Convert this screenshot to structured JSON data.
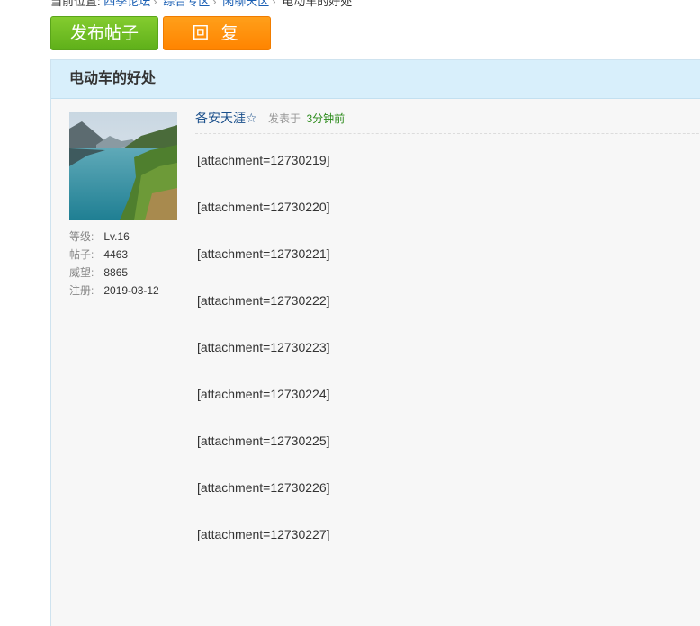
{
  "breadcrumb": {
    "items": [
      "当前位置:",
      "四季论坛",
      "综合专区",
      "闲聊天区",
      "电动车的好处"
    ]
  },
  "actions": {
    "post_label": "发布帖子",
    "reply_label": "回 复"
  },
  "thread": {
    "title": "电动车的好处"
  },
  "author": {
    "name": "各安天涯☆",
    "avatar_alt": "lake and mountain landscape",
    "stats": [
      {
        "label": "等级:",
        "value": "Lv.16"
      },
      {
        "label": "帖子:",
        "value": "4463"
      },
      {
        "label": "威望:",
        "value": "8865"
      },
      {
        "label": "注册:",
        "value": "2019-03-12"
      }
    ]
  },
  "post": {
    "posted_label": "发表于",
    "posted_time": "3分钟前",
    "attachments": [
      "[attachment=12730219]",
      "[attachment=12730220]",
      "[attachment=12730221]",
      "[attachment=12730222]",
      "[attachment=12730223]",
      "[attachment=12730224]",
      "[attachment=12730225]",
      "[attachment=12730226]",
      "[attachment=12730227]"
    ]
  },
  "colors": {
    "post_button": "#6cbd22",
    "reply_button": "#ff8a00",
    "header_bg": "#d8effb",
    "author_link": "#1a4f8b",
    "time_green": "#2b8a1a"
  }
}
